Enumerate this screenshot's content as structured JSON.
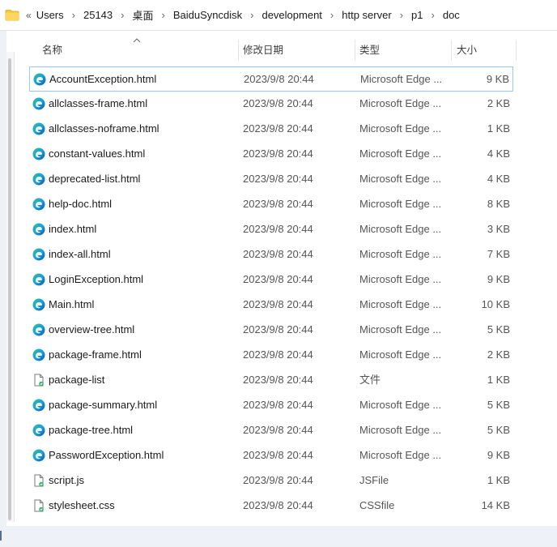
{
  "breadcrumb": {
    "more": "«",
    "items": [
      "Users",
      "25143",
      "桌面",
      "BaiduSyncdisk",
      "development",
      "http server",
      "p1",
      "doc"
    ]
  },
  "columns": {
    "name": "名称",
    "date": "修改日期",
    "type": "类型",
    "size": "大小"
  },
  "files": [
    {
      "name": "AccountException.html",
      "date": "2023/9/8 20:44",
      "type": "Microsoft Edge ...",
      "size": "9 KB",
      "icon": "edge-html-icon",
      "selected": true
    },
    {
      "name": "allclasses-frame.html",
      "date": "2023/9/8 20:44",
      "type": "Microsoft Edge ...",
      "size": "2 KB",
      "icon": "edge-html-icon"
    },
    {
      "name": "allclasses-noframe.html",
      "date": "2023/9/8 20:44",
      "type": "Microsoft Edge ...",
      "size": "1 KB",
      "icon": "edge-html-icon"
    },
    {
      "name": "constant-values.html",
      "date": "2023/9/8 20:44",
      "type": "Microsoft Edge ...",
      "size": "4 KB",
      "icon": "edge-html-icon"
    },
    {
      "name": "deprecated-list.html",
      "date": "2023/9/8 20:44",
      "type": "Microsoft Edge ...",
      "size": "4 KB",
      "icon": "edge-html-icon"
    },
    {
      "name": "help-doc.html",
      "date": "2023/9/8 20:44",
      "type": "Microsoft Edge ...",
      "size": "8 KB",
      "icon": "edge-html-icon"
    },
    {
      "name": "index.html",
      "date": "2023/9/8 20:44",
      "type": "Microsoft Edge ...",
      "size": "3 KB",
      "icon": "edge-html-icon"
    },
    {
      "name": "index-all.html",
      "date": "2023/9/8 20:44",
      "type": "Microsoft Edge ...",
      "size": "7 KB",
      "icon": "edge-html-icon"
    },
    {
      "name": "LoginException.html",
      "date": "2023/9/8 20:44",
      "type": "Microsoft Edge ...",
      "size": "9 KB",
      "icon": "edge-html-icon"
    },
    {
      "name": "Main.html",
      "date": "2023/9/8 20:44",
      "type": "Microsoft Edge ...",
      "size": "10 KB",
      "icon": "edge-html-icon"
    },
    {
      "name": "overview-tree.html",
      "date": "2023/9/8 20:44",
      "type": "Microsoft Edge ...",
      "size": "5 KB",
      "icon": "edge-html-icon"
    },
    {
      "name": "package-frame.html",
      "date": "2023/9/8 20:44",
      "type": "Microsoft Edge ...",
      "size": "2 KB",
      "icon": "edge-html-icon"
    },
    {
      "name": "package-list",
      "date": "2023/9/8 20:44",
      "type": "文件",
      "size": "1 KB",
      "icon": "generic-file-icon"
    },
    {
      "name": "package-summary.html",
      "date": "2023/9/8 20:44",
      "type": "Microsoft Edge ...",
      "size": "5 KB",
      "icon": "edge-html-icon"
    },
    {
      "name": "package-tree.html",
      "date": "2023/9/8 20:44",
      "type": "Microsoft Edge ...",
      "size": "5 KB",
      "icon": "edge-html-icon"
    },
    {
      "name": "PasswordException.html",
      "date": "2023/9/8 20:44",
      "type": "Microsoft Edge ...",
      "size": "9 KB",
      "icon": "edge-html-icon"
    },
    {
      "name": "script.js",
      "date": "2023/9/8 20:44",
      "type": "JSFile",
      "size": "1 KB",
      "icon": "generic-file-icon"
    },
    {
      "name": "stylesheet.css",
      "date": "2023/9/8 20:44",
      "type": "CSSfile",
      "size": "14 KB",
      "icon": "generic-file-icon"
    }
  ],
  "colors": {
    "accent": "#0078d4",
    "selection_border": "#99c9ef",
    "folder": "#f5c542"
  }
}
